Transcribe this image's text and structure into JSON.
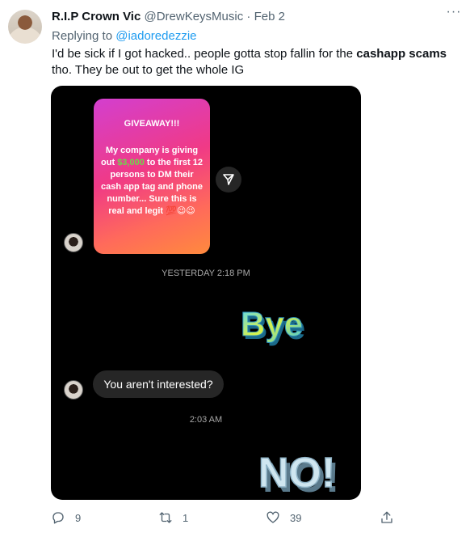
{
  "tweet": {
    "author_name": "R.I.P Crown Vic",
    "handle": "@DrewKeysMusic",
    "separator": "·",
    "date": "Feb 2",
    "more_label": "···",
    "replying_prefix": "Replying to ",
    "replying_to": "@iadoredezzie",
    "text_part1": "I'd be sick if I got hacked.. people gotta stop fallin for the ",
    "text_bold": "cashapp scams",
    "text_part2": " tho.  They be out to get the whole IG"
  },
  "media": {
    "story": {
      "title": "GIVEAWAY!!!",
      "line1": "My company is giving out ",
      "amount": "$3,000",
      "line2": " to the first 12 persons to DM their cash app tag and phone number... Sure this is real and legit ",
      "emoji": "💯😉😉"
    },
    "timestamp1": "YESTERDAY 2:18 PM",
    "sticker_bye": "Bye",
    "message": "You aren't interested?",
    "timestamp2": "2:03 AM",
    "sticker_no": "NO!"
  },
  "actions": {
    "replies": "9",
    "retweets": "1",
    "likes": "39"
  },
  "colors": {
    "link": "#1d9bf0",
    "muted": "#536471",
    "story_gradient_start": "#d33fcf",
    "story_gradient_end": "#ff8a3d",
    "money_green": "#6bd94a"
  }
}
